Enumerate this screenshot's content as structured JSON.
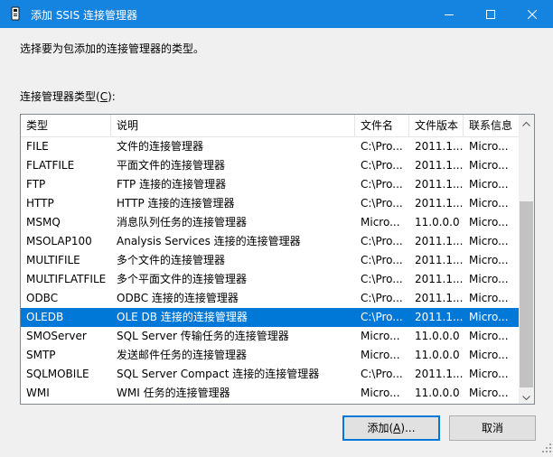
{
  "window": {
    "title": "添加 SSIS 连接管理器",
    "minimize_icon": "minimize-icon",
    "maximize_icon": "maximize-icon",
    "close_icon": "close-icon"
  },
  "instruction": "选择要为包添加的连接管理器的类型。",
  "list_label": {
    "text": "连接管理器类型(",
    "mnemonic": "C",
    "suffix": "):"
  },
  "list": {
    "columns": [
      "类型",
      "说明",
      "文件名",
      "文件版本",
      "联系信息"
    ],
    "selected_row": 9,
    "rows": [
      [
        "FILE",
        "文件的连接管理器",
        "C:\\Pro...",
        "2011.1...",
        "Micro..."
      ],
      [
        "FLATFILE",
        "平面文件的连接管理器",
        "C:\\Pro...",
        "2011.1...",
        "Micro..."
      ],
      [
        "FTP",
        "FTP 连接的连接管理器",
        "C:\\Pro...",
        "2011.1...",
        "Micro..."
      ],
      [
        "HTTP",
        "HTTP 连接的连接管理器",
        "C:\\Pro...",
        "2011.1...",
        "Micro..."
      ],
      [
        "MSMQ",
        "消息队列任务的连接管理器",
        "Micro...",
        "11.0.0.0",
        "Micro..."
      ],
      [
        "MSOLAP100",
        "Analysis Services 连接的连接管理器",
        "C:\\Pro...",
        "2011.1...",
        "Micro..."
      ],
      [
        "MULTIFILE",
        "多个文件的连接管理器",
        "C:\\Pro...",
        "2011.1...",
        "Micro..."
      ],
      [
        "MULTIFLATFILE",
        "多个平面文件的连接管理器",
        "C:\\Pro...",
        "2011.1...",
        "Micro..."
      ],
      [
        "ODBC",
        "ODBC 连接的连接管理器",
        "C:\\Pro...",
        "2011.1...",
        "Micro..."
      ],
      [
        "OLEDB",
        "OLE DB 连接的连接管理器",
        "C:\\Pro...",
        "2011.1...",
        "Micro..."
      ],
      [
        "SMOServer",
        "SQL Server 传输任务的连接管理器",
        "Micro...",
        "11.0.0.0",
        "Micro..."
      ],
      [
        "SMTP",
        "发送邮件任务的连接管理器",
        "Micro...",
        "11.0.0.0",
        "Micro..."
      ],
      [
        "SQLMOBILE",
        "SQL Server Compact 连接的连接管理器",
        "C:\\Pro...",
        "2011.1...",
        "Micro..."
      ],
      [
        "WMI",
        "WMI 任务的连接管理器",
        "Micro...",
        "11.0.0.0",
        "Micro..."
      ]
    ]
  },
  "buttons": {
    "add": {
      "text": "添加(",
      "mnemonic": "A",
      "suffix": ")..."
    },
    "cancel": "取消"
  },
  "colors": {
    "titlebar": "#1584e0",
    "selection": "#0078d7"
  }
}
